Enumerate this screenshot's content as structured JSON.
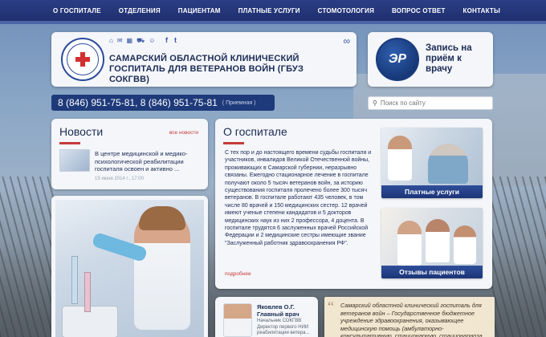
{
  "nav": {
    "items": [
      {
        "label": "О ГОСПИТАЛЕ"
      },
      {
        "label": "ОТДЕЛЕНИЯ"
      },
      {
        "label": "ПАЦИЕНТАМ"
      },
      {
        "label": "ПЛАТНЫЕ УСЛУГИ"
      },
      {
        "label": "СТОМОТОЛОГИЯ"
      },
      {
        "label": "ВОПРОС ОТВЕТ"
      },
      {
        "label": "КОНТАКТЫ"
      }
    ]
  },
  "header": {
    "title": "САМАРСКИЙ ОБЛАСТНОЙ КЛИНИЧЕСКИЙ ГОСПИТАЛЬ ДЛЯ ВЕТЕРАНОВ ВОЙН (ГБУЗ СОКГВВ)",
    "icons": [
      "home-icon",
      "mail-icon",
      "sitemap-icon",
      "ambulance-icon",
      "user-icon"
    ],
    "social": {
      "facebook": "f",
      "twitter": "t"
    }
  },
  "appointment": {
    "label": "Запись на приём к врачу",
    "logo_text": "ЭР"
  },
  "phone": {
    "numbers": "8 (846) 951-75-81, 8 (846) 951-75-81",
    "note": "( Приемная )"
  },
  "search": {
    "placeholder": "Поиск по сайту"
  },
  "news": {
    "title": "Новости",
    "all_link": "все новости",
    "item": {
      "text": "В центре медицинской и медико-психологической реабилитации госпиталя освоен и активно ...",
      "date": "19 июня 2014 г., 17:00"
    }
  },
  "about": {
    "title": "О госпитале",
    "text": "С тех пор и до настоящего времени судьбы госпиталя и участников, инвалидов Великой Отечественной войны, проживающих в Самарской губернии, неразрывно связаны. Ежегодно стационарное лечение в госпитале получают около 5 тысяч ветеранов войн, за историю существования госпиталя пролечено более 300 тысяч ветеранов. В госпитале работают 435 человек, в том числе 80 врачей и 150 медицинских сестер. 12 врачей имеют ученые степени кандидатов и 5 докторов медицинских наук из них 2 профессора, 4 доцента. В госпитале трудятся 6 заслуженных врачей Российской Федерации и 2 медицинские сестры имеющие звание \"Заслуженный работник здравоохранения РФ\".",
    "more_link": "подробнее",
    "tiles": [
      {
        "caption": "Платные услуги"
      },
      {
        "caption": "Отзывы пациентов"
      }
    ]
  },
  "doctor": {
    "name": "Яковлев О.Г.",
    "role": "Главный врач",
    "sub": "Начальник СОКГВВ Директор первого НИИ реабилитации ветера..."
  },
  "quote": {
    "text": "Самарский областной клинический госпиталь для ветеранов войн – Государственное бюджетное учреждение здравоохранения, оказывающее медицинскую помощь (амбулаторно-консультативную, стационарную, стационарноза..."
  },
  "colors": {
    "nav_bg": "#1f2f6e",
    "accent_red": "#c63a3a",
    "card_bg": "#f4f6f9",
    "brand_blue": "#1e3a7a"
  }
}
